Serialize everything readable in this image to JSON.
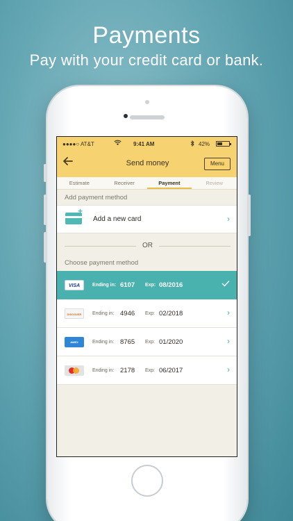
{
  "headline": {
    "title": "Payments",
    "subtitle": "Pay with your credit card or bank."
  },
  "status_bar": {
    "carrier": "●●●●○ AT&T",
    "time": "9:41 AM",
    "battery_pct": "42%",
    "battery_level": 0.42
  },
  "nav": {
    "title": "Send money",
    "menu_label": "Menu"
  },
  "steps": [
    {
      "label": "Estimate"
    },
    {
      "label": "Receiver"
    },
    {
      "label": "Payment",
      "active": true
    },
    {
      "label": "Review",
      "disabled": true
    }
  ],
  "add_section": {
    "label": "Add payment method",
    "add_card_label": "Add a new card"
  },
  "divider_text": "OR",
  "choose_section": {
    "label": "Choose payment method"
  },
  "cards": [
    {
      "brand": "VISA",
      "ending_label": "Ending in:",
      "ending": "6107",
      "exp_label": "Exp:",
      "exp": "08/2016",
      "selected": true
    },
    {
      "brand": "DISCOVER",
      "ending_label": "Ending in:",
      "ending": "4946",
      "exp_label": "Exp:",
      "exp": "02/2018",
      "selected": false
    },
    {
      "brand": "AMEX",
      "ending_label": "Ending in:",
      "ending": "8765",
      "exp_label": "Exp:",
      "exp": "01/2020",
      "selected": false
    },
    {
      "brand": "MASTERCARD",
      "ending_label": "Ending in:",
      "ending": "2178",
      "exp_label": "Exp:",
      "exp": "06/2017",
      "selected": false
    }
  ],
  "colors": {
    "header": "#f7d271",
    "accent_teal": "#49b2ae",
    "screen_bg": "#f2efe7"
  }
}
